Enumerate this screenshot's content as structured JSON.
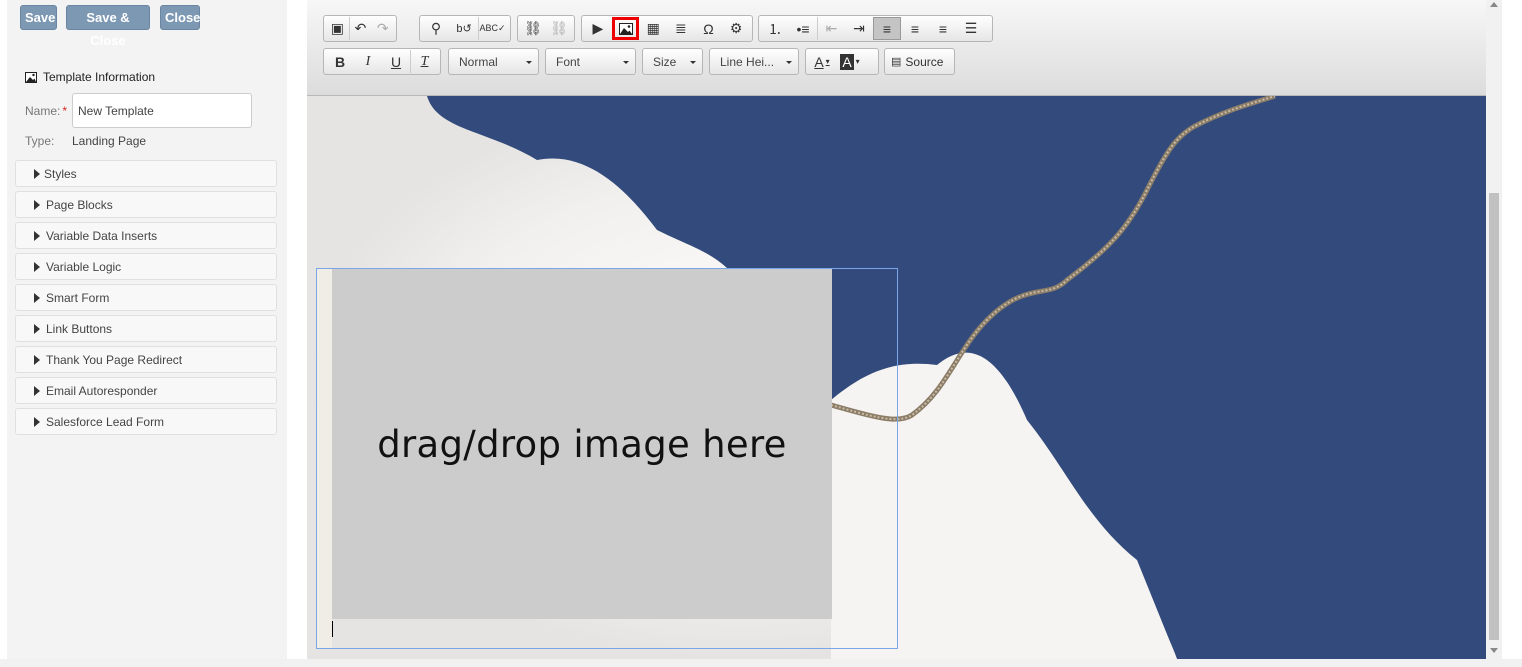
{
  "actions": {
    "save": "Save",
    "save_close": "Save & Close",
    "close": "Close"
  },
  "template_info": {
    "title": "Template Information",
    "name_label": "Name:",
    "required_mark": "*",
    "name_value": "New Template",
    "type_label": "Type:",
    "type_value": "Landing Page"
  },
  "sections": [
    {
      "label": "Styles"
    },
    {
      "label": "Page Blocks"
    },
    {
      "label": "Variable Data Inserts"
    },
    {
      "label": "Variable Logic"
    },
    {
      "label": "Smart Form"
    },
    {
      "label": "Link Buttons"
    },
    {
      "label": "Thank You Page Redirect"
    },
    {
      "label": "Email Autoresponder"
    },
    {
      "label": "Salesforce Lead Form"
    }
  ],
  "toolbar": {
    "format": "Normal",
    "font": "Font",
    "size": "Size",
    "line_height": "Line Hei...",
    "source": "Source",
    "bold": "B",
    "italic": "I",
    "underline": "U",
    "remove_format": "T",
    "text_color": "A",
    "bg_color": "A",
    "special_char": "Ω"
  },
  "editor": {
    "placeholder_text": "drag/drop image here"
  },
  "colors": {
    "button": "#7d98b3",
    "sky": "#324a7c",
    "highlight": "#e00000"
  }
}
